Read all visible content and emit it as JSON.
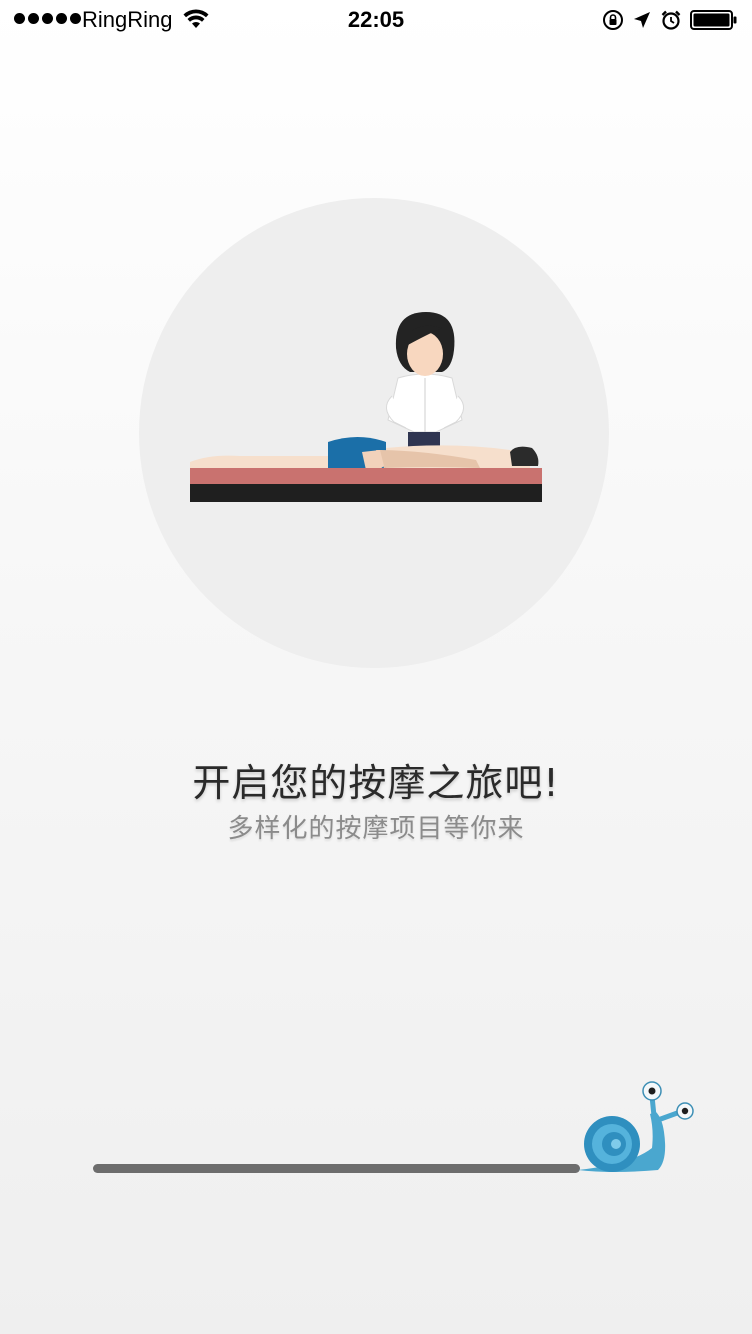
{
  "status_bar": {
    "carrier": "RingRing",
    "time": "22:05",
    "signal_icon": "signal-dots-icon",
    "wifi_icon": "wifi-icon",
    "rotation_lock_icon": "rotation-lock-icon",
    "location_icon": "location-arrow-icon",
    "alarm_icon": "alarm-clock-icon",
    "battery_icon": "battery-icon"
  },
  "onboarding": {
    "illustration_icon": "massage-illustration",
    "headline": "开启您的按摩之旅吧!",
    "subline": "多样化的按摩项目等你来"
  },
  "loading": {
    "progress": 0.86,
    "indicator_icon": "snail-icon",
    "bar_color": "#6d6d6d"
  },
  "colors": {
    "background": "#f5f5f5",
    "circle": "#eeeeee",
    "headline": "#2a2a2a",
    "subline": "#8b8b8b"
  }
}
